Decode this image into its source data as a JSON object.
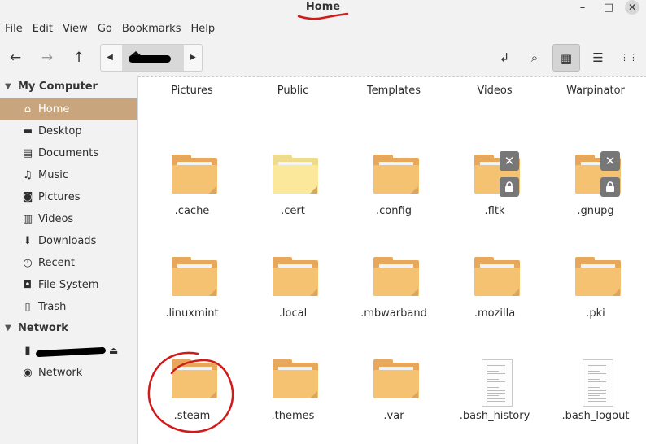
{
  "window": {
    "title": "Home",
    "minimize": "–",
    "maximize": "□",
    "close": "✕"
  },
  "menu": [
    "File",
    "Edit",
    "View",
    "Go",
    "Bookmarks",
    "Help"
  ],
  "toolbar": {
    "back": "←",
    "forward": "→",
    "up": "↑",
    "path_left": "◀",
    "path_right": "▶",
    "toggle_location": "↲",
    "search": "⌕",
    "icon_view": "▦",
    "list_view": "☰",
    "compact_view": "⋮⋮"
  },
  "sidebar": {
    "sections": [
      {
        "header": "My Computer",
        "items": [
          {
            "icon": "home-icon",
            "glyph": "⌂",
            "label": "Home",
            "active": true
          },
          {
            "icon": "desktop-icon",
            "glyph": "▬",
            "label": "Desktop"
          },
          {
            "icon": "documents-icon",
            "glyph": "▤",
            "label": "Documents"
          },
          {
            "icon": "music-icon",
            "glyph": "♫",
            "label": "Music"
          },
          {
            "icon": "pictures-icon",
            "glyph": "◙",
            "label": "Pictures"
          },
          {
            "icon": "videos-icon",
            "glyph": "▥",
            "label": "Videos"
          },
          {
            "icon": "downloads-icon",
            "glyph": "⬇",
            "label": "Downloads"
          },
          {
            "icon": "recent-icon",
            "glyph": "◷",
            "label": "Recent"
          },
          {
            "icon": "filesystem-icon",
            "glyph": "◘",
            "label": "File System"
          },
          {
            "icon": "trash-icon",
            "glyph": "▯",
            "label": "Trash"
          }
        ]
      },
      {
        "header": "Network",
        "items": [
          {
            "icon": "drive-icon",
            "glyph": "▮",
            "label": ""
          },
          {
            "icon": "network-icon",
            "glyph": "◉",
            "label": "Network"
          }
        ]
      }
    ]
  },
  "files": [
    {
      "name": "Pictures",
      "type": "folder-partial"
    },
    {
      "name": "Public",
      "type": "folder-partial"
    },
    {
      "name": "Templates",
      "type": "folder-partial"
    },
    {
      "name": "Videos",
      "type": "folder-partial"
    },
    {
      "name": "Warpinator",
      "type": "folder-partial"
    },
    {
      "name": ".cache",
      "type": "folder"
    },
    {
      "name": ".cert",
      "type": "folder-light"
    },
    {
      "name": ".config",
      "type": "folder"
    },
    {
      "name": ".fltk",
      "type": "folder-locked"
    },
    {
      "name": ".gnupg",
      "type": "folder-locked"
    },
    {
      "name": ".linuxmint",
      "type": "folder"
    },
    {
      "name": ".local",
      "type": "folder"
    },
    {
      "name": ".mbwarband",
      "type": "folder"
    },
    {
      "name": ".mozilla",
      "type": "folder"
    },
    {
      "name": ".pki",
      "type": "folder"
    },
    {
      "name": ".steam",
      "type": "folder"
    },
    {
      "name": ".themes",
      "type": "folder"
    },
    {
      "name": ".var",
      "type": "folder"
    },
    {
      "name": ".bash_history",
      "type": "text"
    },
    {
      "name": ".bash_logout",
      "type": "text"
    }
  ],
  "emblems": {
    "unreadable": "✕",
    "locked": "🔒"
  },
  "colors": {
    "selected": "#c9a57e",
    "folder": "#f5c271",
    "annotation": "#d11a1a"
  }
}
